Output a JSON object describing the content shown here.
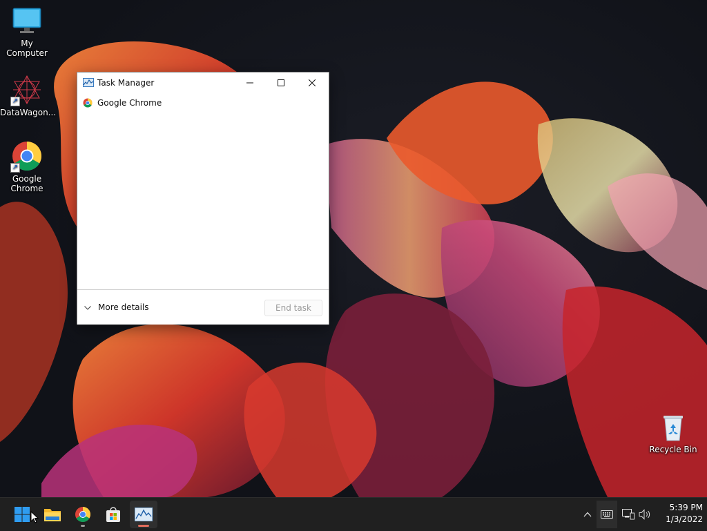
{
  "desktop": {
    "icons": [
      {
        "label": "My Computer"
      },
      {
        "label": "DataWagon..."
      },
      {
        "label": "Google Chrome"
      },
      {
        "label": "Recycle Bin"
      }
    ]
  },
  "task_manager": {
    "title": "Task Manager",
    "processes": [
      {
        "name": "Google Chrome",
        "icon": "chrome-icon"
      }
    ],
    "more_details_label": "More details",
    "end_task_label": "End task",
    "end_task_enabled": false
  },
  "taskbar": {
    "items": [
      {
        "name": "start-button",
        "icon": "windows-logo-icon"
      },
      {
        "name": "file-explorer-button",
        "icon": "folder-icon"
      },
      {
        "name": "chrome-taskbar-button",
        "icon": "chrome-icon",
        "running": true
      },
      {
        "name": "microsoft-store-button",
        "icon": "store-icon"
      },
      {
        "name": "task-manager-taskbar-button",
        "icon": "task-manager-icon",
        "running": true,
        "active": true
      }
    ],
    "clock": {
      "time": "5:39 PM",
      "date": "1/3/2022"
    }
  },
  "colors": {
    "taskbar": "#202020",
    "active_indicator": "#e06c5c",
    "running_indicator": "#9a9a9a",
    "window_bg": "#ffffff"
  }
}
